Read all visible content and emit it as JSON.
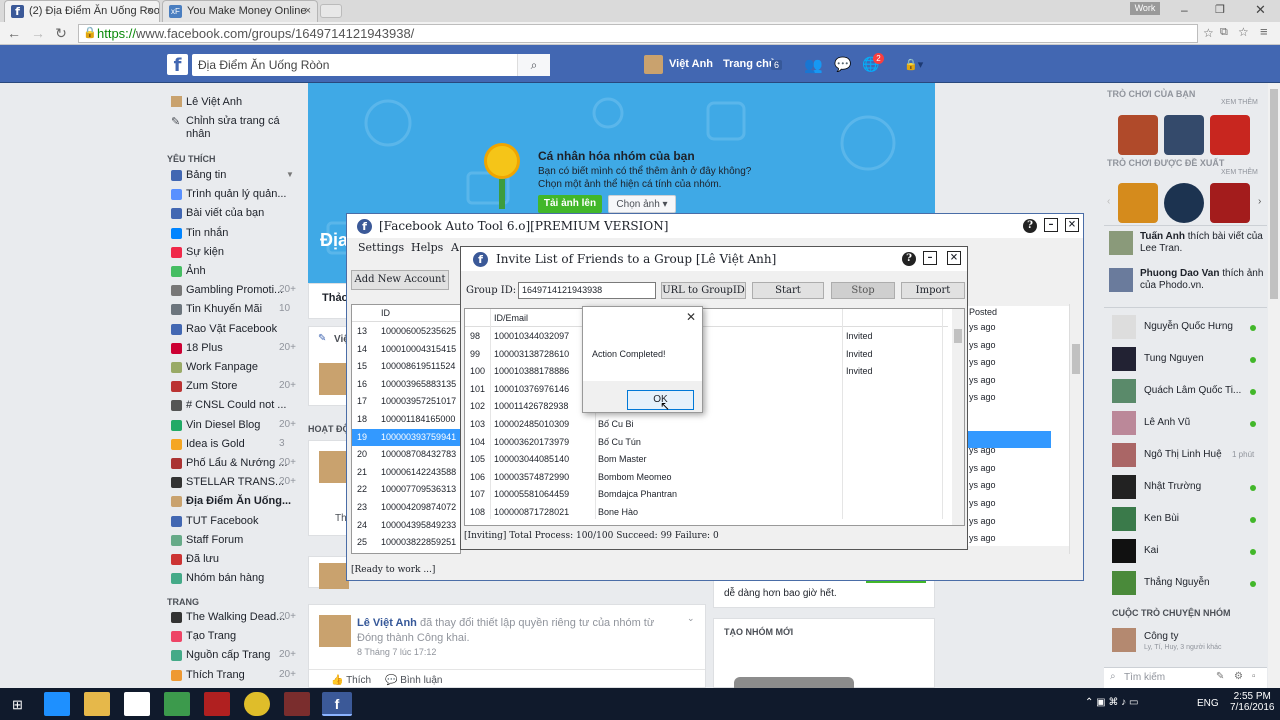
{
  "browser": {
    "tabs": [
      {
        "title": "(2) Địa Điểm Ăn Uống Roo"
      },
      {
        "title": "You Make Money Online"
      }
    ],
    "url_scheme": "https://",
    "url_rest": "www.facebook.com/groups/1649714121943938/",
    "work_label": "Work"
  },
  "fbbar": {
    "logo": "f",
    "search_value": "Địa Điểm Ăn Uống Ròòn",
    "user_name": "Việt Anh",
    "home_label": "Trang chủ",
    "home_count": "6",
    "notif_count": "2"
  },
  "left": {
    "profile_name": "Lê Việt Anh",
    "edit_profile": "Chỉnh sửa trang cá nhân",
    "favorites_head": "YÊU THÍCH",
    "favorites": [
      {
        "label": "Bảng tin",
        "count": ""
      },
      {
        "label": "Trình quản lý quản...",
        "count": ""
      },
      {
        "label": "Bài viết của bạn",
        "count": ""
      },
      {
        "label": "Tin nhắn",
        "count": ""
      },
      {
        "label": "Sự kiện",
        "count": ""
      },
      {
        "label": "Ảnh",
        "count": ""
      },
      {
        "label": "Gambling Promoti...",
        "count": "20+"
      },
      {
        "label": "Tin Khuyến Mãi",
        "count": "10"
      },
      {
        "label": "Rao Vặt Facebook",
        "count": ""
      },
      {
        "label": "18 Plus",
        "count": "20+"
      },
      {
        "label": "Work Fanpage",
        "count": ""
      },
      {
        "label": "Zum Store",
        "count": "20+"
      },
      {
        "label": "# CNSL Could not ...",
        "count": ""
      },
      {
        "label": "Vin Diesel Blog",
        "count": "20+"
      },
      {
        "label": "Idea is Gold",
        "count": "3"
      },
      {
        "label": "Phố Lẩu & Nướng ...",
        "count": "20+"
      },
      {
        "label": "STELLAR TRANS...",
        "count": "20+"
      },
      {
        "label": "Địa Điểm Ăn Uống...",
        "count": ""
      },
      {
        "label": "TUT Facebook",
        "count": ""
      },
      {
        "label": "Staff Forum",
        "count": ""
      },
      {
        "label": "Đã lưu",
        "count": ""
      },
      {
        "label": "Nhóm bán hàng",
        "count": ""
      }
    ],
    "pages_head": "TRANG",
    "pages": [
      {
        "label": "The Walking Dead...",
        "count": "20+"
      },
      {
        "label": "Tạo Trang",
        "count": ""
      },
      {
        "label": "Nguồn cấp Trang",
        "count": "20+"
      },
      {
        "label": "Thích Trang",
        "count": "20+"
      }
    ]
  },
  "cover": {
    "title": "Cá nhân hóa nhóm của bạn",
    "desc1": "Bạn có biết mình có thể thêm ảnh ở đây không?",
    "desc2": "Chọn một ảnh thể hiện cá tính của nhóm.",
    "upload_btn": "Tải ảnh lên",
    "choose_btn": "Chọn ảnh",
    "group_name_peek": "Địa",
    "tab_peek": "Thảo",
    "hoat_peek": "HOẠT ĐỘ"
  },
  "feed": {
    "post_author": "Lê Việt Anh",
    "post_text": " đã thay đổi thiết lập quyền riêng tư của nhóm từ Đóng thành Công khai.",
    "post_time": "8 Tháng 7 lúc 17:12",
    "like": "Thích",
    "comment": "Bình luận",
    "like_peek": "Thí",
    "viet_peek": "Việ",
    "side_text": "dễ dàng hơn bao giờ hết.",
    "create_group": "TẠO NHÓM MỚI"
  },
  "right": {
    "games_head": "TRÒ CHƠI CỦA BẠN",
    "see_more": "XEM THÊM",
    "suggest_head": "TRÒ CHƠI ĐƯỢC ĐỀ XUẤT",
    "activity": [
      {
        "name": "Tuấn Anh",
        "text": " thích bài viết của Lee Tran."
      },
      {
        "name": "Phuong Dao Van",
        "text": " thích ảnh của Phodo.vn."
      }
    ],
    "contacts": [
      {
        "name": "Nguyễn Quốc Hưng",
        "status": ""
      },
      {
        "name": "Tung Nguyen",
        "status": ""
      },
      {
        "name": "Quách Lâm Quốc Ti...",
        "status": ""
      },
      {
        "name": "Lê Anh Vũ",
        "status": ""
      },
      {
        "name": "Ngô Thị Linh Huệ",
        "status": "1 phút"
      },
      {
        "name": "Nhật Trường",
        "status": ""
      },
      {
        "name": "Ken Bùi",
        "status": ""
      },
      {
        "name": "Kai",
        "status": ""
      },
      {
        "name": "Thắng Nguyễn",
        "status": ""
      }
    ],
    "group_chat_head": "CUỘC TRÒ CHUYỆN NHÓM",
    "group_chat_name": "Công ty",
    "group_chat_members": "Ly, Tí, Huy, 3 người khác",
    "search_placeholder": "Tìm kiếm"
  },
  "tool": {
    "title": "[Facebook Auto Tool 6.o][PREMIUM VERSION]",
    "menu": [
      "Settings",
      "Helps",
      "A"
    ],
    "add_account": "Add New Account",
    "col_id": "ID",
    "col_posted": "Posted",
    "status": "[Ready to work ...]",
    "rows": [
      {
        "n": "13",
        "id": "100006005235625",
        "ago": "ys ago"
      },
      {
        "n": "14",
        "id": "100010004315415",
        "ago": "ys ago"
      },
      {
        "n": "15",
        "id": "100008619511524",
        "ago": "ys ago"
      },
      {
        "n": "16",
        "id": "100003965883135",
        "ago": "ys ago"
      },
      {
        "n": "17",
        "id": "100003957251017",
        "ago": "ys ago"
      },
      {
        "n": "18",
        "id": "100001184165000",
        "ago": ""
      },
      {
        "n": "19",
        "id": "100000393759941",
        "ago": ""
      },
      {
        "n": "20",
        "id": "100008708432783",
        "ago": "ys ago"
      },
      {
        "n": "21",
        "id": "100006142243588",
        "ago": "ys ago"
      },
      {
        "n": "22",
        "id": "100007709536313",
        "ago": "ys ago"
      },
      {
        "n": "23",
        "id": "100004209874072",
        "ago": "ys ago"
      },
      {
        "n": "24",
        "id": "100004395849233",
        "ago": "ys ago"
      },
      {
        "n": "25",
        "id": "100003822859251",
        "ago": "ys ago"
      }
    ]
  },
  "invite": {
    "title": "Invite List of Friends to a Group [Lê Việt Anh]",
    "group_label": "Group ID:",
    "group_value": "1649714121943938",
    "btn_url": "URL to GroupID",
    "btn_start": "Start",
    "btn_stop": "Stop",
    "btn_import": "Import",
    "col_id": "ID/Email",
    "rows": [
      {
        "n": "98",
        "id": "100010344032097",
        "name": "",
        "status": "Invited"
      },
      {
        "n": "99",
        "id": "100003138728610",
        "name": "",
        "status": "Invited"
      },
      {
        "n": "100",
        "id": "100010388178886",
        "name": "",
        "status": "Invited"
      },
      {
        "n": "101",
        "id": "100010376976146",
        "name": "",
        "status": ""
      },
      {
        "n": "102",
        "id": "100011426782938",
        "name": "",
        "status": ""
      },
      {
        "n": "103",
        "id": "100002485010309",
        "name": "Bố Cu Bi",
        "status": ""
      },
      {
        "n": "104",
        "id": "100003620173979",
        "name": "Bố Cu Tún",
        "status": ""
      },
      {
        "n": "105",
        "id": "100003044085140",
        "name": "Bom Master",
        "status": ""
      },
      {
        "n": "106",
        "id": "100003574872990",
        "name": "Bombom Meomeo",
        "status": ""
      },
      {
        "n": "107",
        "id": "100005581064459",
        "name": "Bomdajca Phantran",
        "status": ""
      },
      {
        "n": "108",
        "id": "100000871728021",
        "name": "Bone Hào",
        "status": ""
      }
    ],
    "summary": "[Inviting] Total Process: 100/100  Succeed: 99 Failure: 0"
  },
  "dialog": {
    "message": "Action Completed!",
    "ok": "OK"
  },
  "taskbar": {
    "lang": "ENG",
    "time": "2:55 PM",
    "date": "7/16/2016"
  },
  "colors": {
    "fb_blue": "#4267b2",
    "cover_blue": "#3fa9e6",
    "online_green": "#42b72a",
    "selection_blue": "#3399ff"
  }
}
